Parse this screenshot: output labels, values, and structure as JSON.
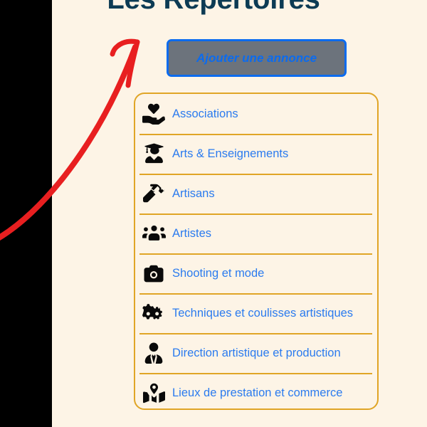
{
  "page": {
    "title": "Les Répertoires",
    "background_color": "#FDF4E6",
    "title_color": "#0C3B54",
    "gutter_color": "#000000"
  },
  "add_button": {
    "label": "Ajouter une annonce",
    "background_color": "#6C737C",
    "border_color": "#0B6BEF",
    "text_color": "#0B6BEF"
  },
  "directory_panel": {
    "border_color": "#E0A526",
    "link_color": "#2B7BEF",
    "items": [
      {
        "label": "Associations",
        "icon": "hand-holding-heart-icon"
      },
      {
        "label": "Arts & Enseignements",
        "icon": "user-graduate-icon"
      },
      {
        "label": "Artisans",
        "icon": "hammer-icon"
      },
      {
        "label": "Artistes",
        "icon": "users-group-icon"
      },
      {
        "label": "Shooting et mode",
        "icon": "camera-icon"
      },
      {
        "label": "Techniques et coulisses artistiques",
        "icon": "cogs-icon"
      },
      {
        "label": "Direction artistique et production",
        "icon": "user-tie-icon"
      },
      {
        "label": "Lieux de prestation et commerce",
        "icon": "map-marked-icon"
      }
    ]
  },
  "annotation": {
    "type": "arrow",
    "color": "#E81F20",
    "points_to": "add_button"
  }
}
